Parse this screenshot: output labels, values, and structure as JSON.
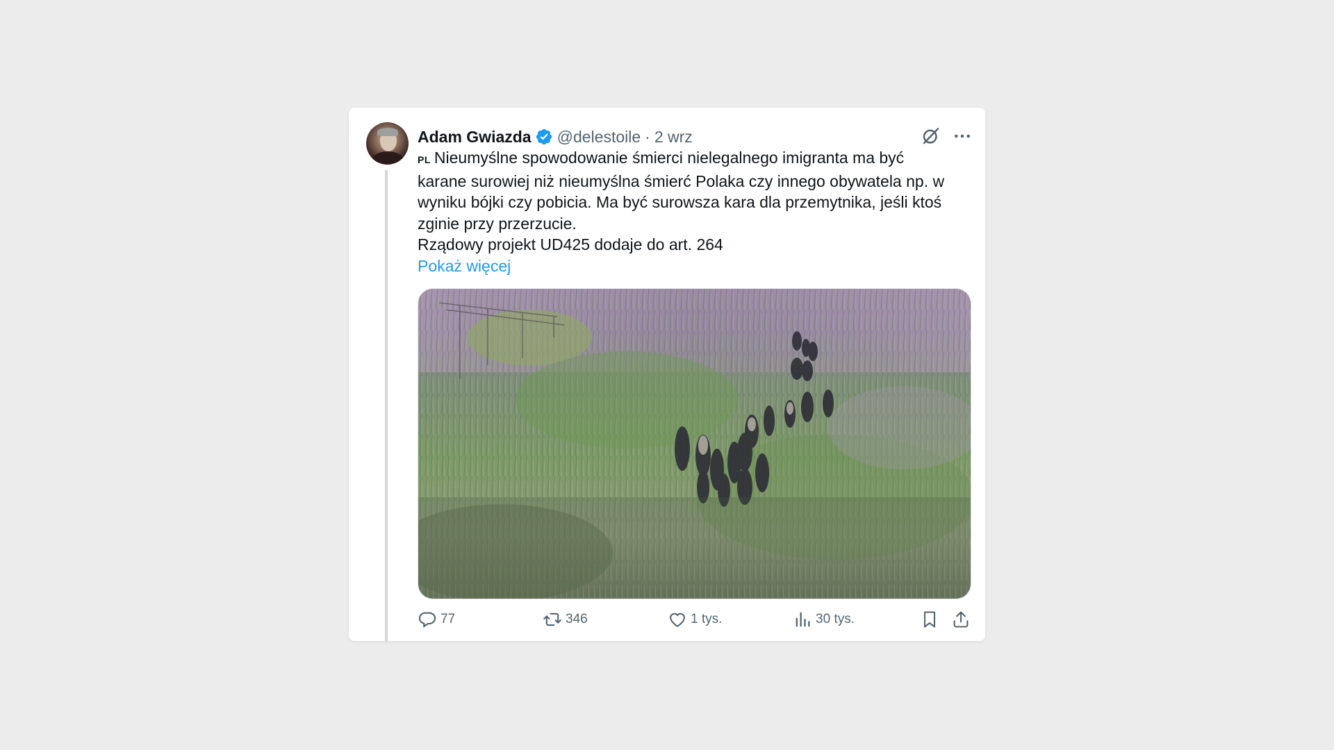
{
  "tweet": {
    "author": {
      "name": "Adam Gwiazda",
      "handle": "@delestoile",
      "verified": true
    },
    "separator": "·",
    "date": "2 wrz",
    "lang_badge": "PL",
    "text_lines": [
      "Nieumyślne spowodowanie śmierci nielegalnego imigranta ma być",
      "karane surowiej niż nieumyślna śmierć Polaka czy innego obywatela np. w",
      "wyniku bójki czy pobicia. Ma być surowsza kara dla przemytnika, jeśli ktoś",
      "zginie przy przerzucie.",
      "Rządowy projekt UD425 dodaje do art. 264"
    ],
    "show_more": "Pokaż więcej",
    "media": {
      "description_icon": "photo-of-group-walking-through-tall-grass"
    },
    "actions": {
      "replies": "77",
      "retweets": "346",
      "likes": "1 tys.",
      "views": "30 tys."
    }
  },
  "colors": {
    "accent": "#1d9bf0",
    "text_primary": "#0f1419",
    "text_secondary": "#536471",
    "thread_line": "#cfd9de",
    "background": "#ececec"
  },
  "icons": {
    "verified": "verified-badge-icon",
    "grok": "grok-icon",
    "more": "more-dots-icon",
    "reply": "reply-icon",
    "retweet": "retweet-icon",
    "like": "heart-icon",
    "views": "views-chart-icon",
    "bookmark": "bookmark-icon",
    "share": "share-icon"
  }
}
